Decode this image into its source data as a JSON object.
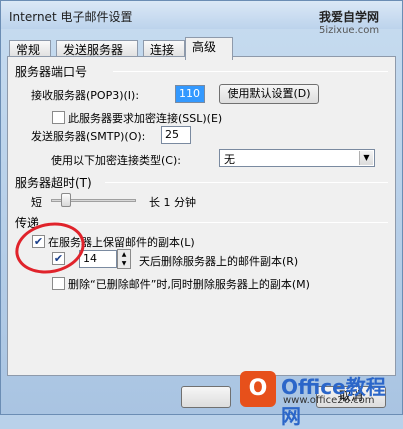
{
  "window": {
    "title": "Internet 电子邮件设置"
  },
  "watermark_top": {
    "line1": "我爱自学网",
    "line2": "5izixue.com"
  },
  "tabs": [
    {
      "label": "常规"
    },
    {
      "label": "发送服务器"
    },
    {
      "label": "连接"
    },
    {
      "label": "高级"
    }
  ],
  "ports": {
    "section_title": "服务器端口号",
    "incoming_label": "接收服务器(POP3)(I):",
    "incoming_value": "110",
    "default_button": "使用默认设置(D)",
    "ssl_label": "此服务器要求加密连接(SSL)(E)",
    "outgoing_label": "发送服务器(SMTP)(O):",
    "outgoing_value": "25",
    "encryption_label": "使用以下加密连接类型(C):",
    "encryption_value": "无"
  },
  "timeout": {
    "section_title": "服务器超时(T)",
    "short_label": "短",
    "long_label": "长 1 分钟"
  },
  "delivery": {
    "section_title": "传递",
    "keep_copy_label": "在服务器上保留邮件的副本(L)",
    "days_value": "14",
    "remove_after_label": "天后删除服务器上的邮件副本(R)",
    "remove_deleted_label": "删除“已删除邮件”时,同时删除服务器上的副本(M)"
  },
  "bottom": {
    "cancel_label": "取消"
  },
  "watermark_bottom": {
    "logo_glyph": "O",
    "brand": "Office教程网",
    "url": "www.office26.com"
  },
  "colors": {
    "accent": "#3399ff",
    "ring": "#e0232b",
    "brand": "#e7501b"
  }
}
